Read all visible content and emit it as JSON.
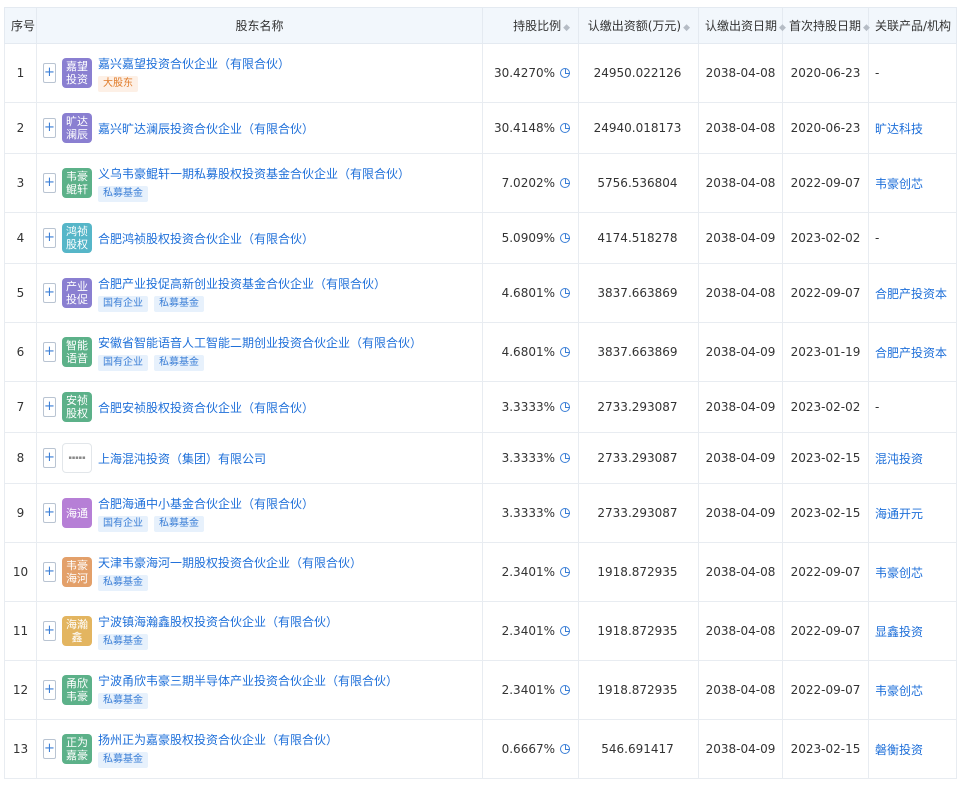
{
  "headers": {
    "idx": "序号",
    "name": "股东名称",
    "ratio": "持股比例",
    "amount": "认缴出资额(万元)",
    "date": "认缴出资日期",
    "first": "首次持股日期",
    "related": "关联产品/机构"
  },
  "sort_glyph": "◆",
  "rows": [
    {
      "idx": "1",
      "logo": "嘉望投资",
      "logo_color": "#8a7fd1",
      "name": "嘉兴嘉望投资合伙企业（有限合伙）",
      "tags": [
        {
          "text": "大股东",
          "style": "orange"
        }
      ],
      "ratio": "30.4270%",
      "amount": "24950.022126",
      "date": "2038-04-08",
      "first": "2020-06-23",
      "related": "-"
    },
    {
      "idx": "2",
      "logo": "旷达澜辰",
      "logo_color": "#8a7fd1",
      "name": "嘉兴旷达澜辰投资合伙企业（有限合伙）",
      "tags": [],
      "ratio": "30.4148%",
      "amount": "24940.018173",
      "date": "2038-04-08",
      "first": "2020-06-23",
      "related": "旷达科技"
    },
    {
      "idx": "3",
      "logo": "韦豪鲲轩",
      "logo_color": "#5cb189",
      "name": "义乌韦豪鲲轩一期私募股权投资基金合伙企业（有限合伙）",
      "tags": [
        {
          "text": "私募基金",
          "style": "blue"
        }
      ],
      "ratio": "7.0202%",
      "amount": "5756.536804",
      "date": "2038-04-08",
      "first": "2022-09-07",
      "related": "韦豪创芯"
    },
    {
      "idx": "4",
      "logo": "鸿祯股权",
      "logo_color": "#56b6c8",
      "name": "合肥鸿祯股权投资合伙企业（有限合伙）",
      "tags": [],
      "ratio": "5.0909%",
      "amount": "4174.518278",
      "date": "2038-04-09",
      "first": "2023-02-02",
      "related": "-"
    },
    {
      "idx": "5",
      "logo": "产业投促",
      "logo_color": "#8a7fd1",
      "name": "合肥产业投促高新创业投资基金合伙企业（有限合伙）",
      "tags": [
        {
          "text": "国有企业",
          "style": "blue"
        },
        {
          "text": "私募基金",
          "style": "blue"
        }
      ],
      "ratio": "4.6801%",
      "amount": "3837.663869",
      "date": "2038-04-08",
      "first": "2022-09-07",
      "related": "合肥产投资本"
    },
    {
      "idx": "6",
      "logo": "智能语音",
      "logo_color": "#5cb189",
      "name": "安徽省智能语音人工智能二期创业投资合伙企业（有限合伙）",
      "tags": [
        {
          "text": "国有企业",
          "style": "blue"
        },
        {
          "text": "私募基金",
          "style": "blue"
        }
      ],
      "ratio": "4.6801%",
      "amount": "3837.663869",
      "date": "2038-04-09",
      "first": "2023-01-19",
      "related": "合肥产投资本"
    },
    {
      "idx": "7",
      "logo": "安祯股权",
      "logo_color": "#5cb189",
      "name": "合肥安祯股权投资合伙企业（有限合伙）",
      "tags": [],
      "ratio": "3.3333%",
      "amount": "2733.293087",
      "date": "2038-04-09",
      "first": "2023-02-02",
      "related": "-"
    },
    {
      "idx": "8",
      "logo": "",
      "logo_color": "#ffffff",
      "name": "上海混沌投资（集团）有限公司",
      "tags": [],
      "ratio": "3.3333%",
      "amount": "2733.293087",
      "date": "2038-04-09",
      "first": "2023-02-15",
      "related": "混沌投资"
    },
    {
      "idx": "9",
      "logo": "海通",
      "logo_color": "#b67fd6",
      "name": "合肥海通中小基金合伙企业（有限合伙）",
      "tags": [
        {
          "text": "国有企业",
          "style": "blue"
        },
        {
          "text": "私募基金",
          "style": "blue"
        }
      ],
      "ratio": "3.3333%",
      "amount": "2733.293087",
      "date": "2038-04-09",
      "first": "2023-02-15",
      "related": "海通开元"
    },
    {
      "idx": "10",
      "logo": "韦豪海河",
      "logo_color": "#e3a06a",
      "name": "天津韦豪海河一期股权投资合伙企业（有限合伙）",
      "tags": [
        {
          "text": "私募基金",
          "style": "blue"
        }
      ],
      "ratio": "2.3401%",
      "amount": "1918.872935",
      "date": "2038-04-08",
      "first": "2022-09-07",
      "related": "韦豪创芯"
    },
    {
      "idx": "11",
      "logo": "海瀚鑫",
      "logo_color": "#e3b560",
      "name": "宁波镇海瀚鑫股权投资合伙企业（有限合伙）",
      "tags": [
        {
          "text": "私募基金",
          "style": "blue"
        }
      ],
      "ratio": "2.3401%",
      "amount": "1918.872935",
      "date": "2038-04-08",
      "first": "2022-09-07",
      "related": "显鑫投资"
    },
    {
      "idx": "12",
      "logo": "甬欣韦豪",
      "logo_color": "#5cb189",
      "name": "宁波甬欣韦豪三期半导体产业投资合伙企业（有限合伙）",
      "tags": [
        {
          "text": "私募基金",
          "style": "blue"
        }
      ],
      "ratio": "2.3401%",
      "amount": "1918.872935",
      "date": "2038-04-08",
      "first": "2022-09-07",
      "related": "韦豪创芯"
    },
    {
      "idx": "13",
      "logo": "正为嘉豪",
      "logo_color": "#5cb189",
      "name": "扬州正为嘉豪股权投资合伙企业（有限合伙）",
      "tags": [
        {
          "text": "私募基金",
          "style": "blue"
        }
      ],
      "ratio": "0.6667%",
      "amount": "546.691417",
      "date": "2038-04-09",
      "first": "2023-02-15",
      "related": "磐衡投资"
    }
  ]
}
